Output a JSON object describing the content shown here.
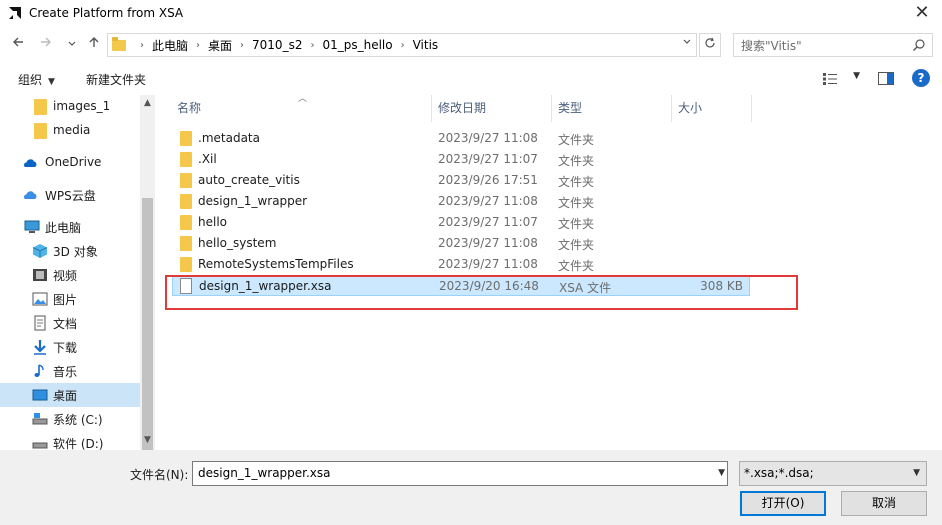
{
  "window": {
    "title": "Create Platform from XSA",
    "close_glyph": "✕"
  },
  "address": {
    "crumbs": [
      "此电脑",
      "桌面",
      "7010_s2",
      "01_ps_hello",
      "Vitis"
    ],
    "search_placeholder": "搜索\"Vitis\""
  },
  "toolbar": {
    "organize_label": "组织",
    "new_folder_label": "新建文件夹"
  },
  "sidebar": {
    "items": [
      {
        "label": "images_1",
        "icon": "folder-icon"
      },
      {
        "label": "media",
        "icon": "folder-icon"
      },
      {
        "label": "OneDrive",
        "icon": "cloud-icon"
      },
      {
        "label": "WPS云盘",
        "icon": "wps-cloud-icon"
      },
      {
        "label": "此电脑",
        "icon": "computer-icon"
      },
      {
        "label": "3D 对象",
        "icon": "3d-objects-icon"
      },
      {
        "label": "视频",
        "icon": "video-icon"
      },
      {
        "label": "图片",
        "icon": "pictures-icon"
      },
      {
        "label": "文档",
        "icon": "documents-icon"
      },
      {
        "label": "下载",
        "icon": "download-icon"
      },
      {
        "label": "音乐",
        "icon": "music-icon"
      },
      {
        "label": "桌面",
        "icon": "desktop-icon"
      },
      {
        "label": "系统 (C:)",
        "icon": "drive-icon"
      },
      {
        "label": "软件 (D:)",
        "icon": "drive-icon"
      }
    ],
    "selected": "桌面"
  },
  "columns": {
    "name": "名称",
    "date": "修改日期",
    "type": "类型",
    "size": "大小"
  },
  "files": [
    {
      "name": ".metadata",
      "date": "2023/9/27 11:08",
      "type": "文件夹",
      "size": ""
    },
    {
      "name": ".Xil",
      "date": "2023/9/27 11:07",
      "type": "文件夹",
      "size": ""
    },
    {
      "name": "auto_create_vitis",
      "date": "2023/9/26 17:51",
      "type": "文件夹",
      "size": ""
    },
    {
      "name": "design_1_wrapper",
      "date": "2023/9/27 11:08",
      "type": "文件夹",
      "size": ""
    },
    {
      "name": "hello",
      "date": "2023/9/27 11:07",
      "type": "文件夹",
      "size": ""
    },
    {
      "name": "hello_system",
      "date": "2023/9/27 11:08",
      "type": "文件夹",
      "size": ""
    },
    {
      "name": "RemoteSystemsTempFiles",
      "date": "2023/9/27 11:08",
      "type": "文件夹",
      "size": ""
    },
    {
      "name": "design_1_wrapper.xsa",
      "date": "2023/9/20 16:48",
      "type": "XSA 文件",
      "size": "308 KB"
    }
  ],
  "bottom": {
    "filename_label": "文件名(N):",
    "filename_value": "design_1_wrapper.xsa",
    "filter_value": "*.xsa;*.dsa;",
    "open_label": "打开(O)",
    "cancel_label": "取消"
  },
  "colors": {
    "selection": "#cce8ff",
    "highlight_box": "#e03a3a",
    "accent": "#0078d7"
  }
}
